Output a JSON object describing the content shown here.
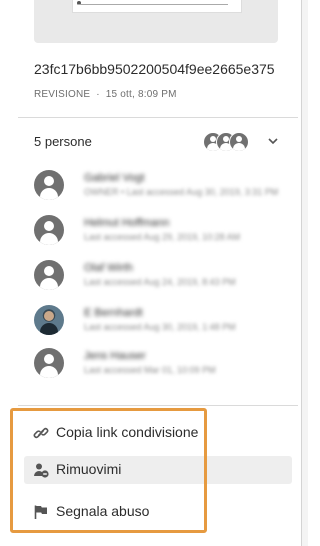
{
  "file": {
    "name": "23fc17b6bb9502200504f9ee2665e375",
    "revision_label": "REVISIONE",
    "revision_separator": "·",
    "revision_date": "15 ott, 8:09 PM"
  },
  "people": {
    "count_label": "5 persone",
    "list": [
      {
        "name": "Gabriel Vogt",
        "detail": "OWNER • Last accessed Aug 30, 2019, 3:31 PM",
        "avatar": "user-icon"
      },
      {
        "name": "Helmut Hoffmann",
        "detail": "Last accessed Aug 29, 2019, 10:28 AM",
        "avatar": "user-icon"
      },
      {
        "name": "Olaf Wirth",
        "detail": "Last accessed Aug 24, 2019, 8:43 PM",
        "avatar": "user-icon"
      },
      {
        "name": "E Bernhardt",
        "detail": "Last accessed Aug 30, 2019, 1:48 PM",
        "avatar": "user-photo"
      },
      {
        "name": "Jens Hauser",
        "detail": "Last accessed Mar 01, 10:09 PM",
        "avatar": "user-icon"
      }
    ]
  },
  "menu": {
    "copy_link": "Copia link condivisione",
    "remove_me": "Rimuovimi",
    "report_abuse": "Segnala abuso"
  },
  "colors": {
    "highlight_border": "#e69a40",
    "avatar_gray": "#707070",
    "hover_bg": "#eeeeee"
  }
}
